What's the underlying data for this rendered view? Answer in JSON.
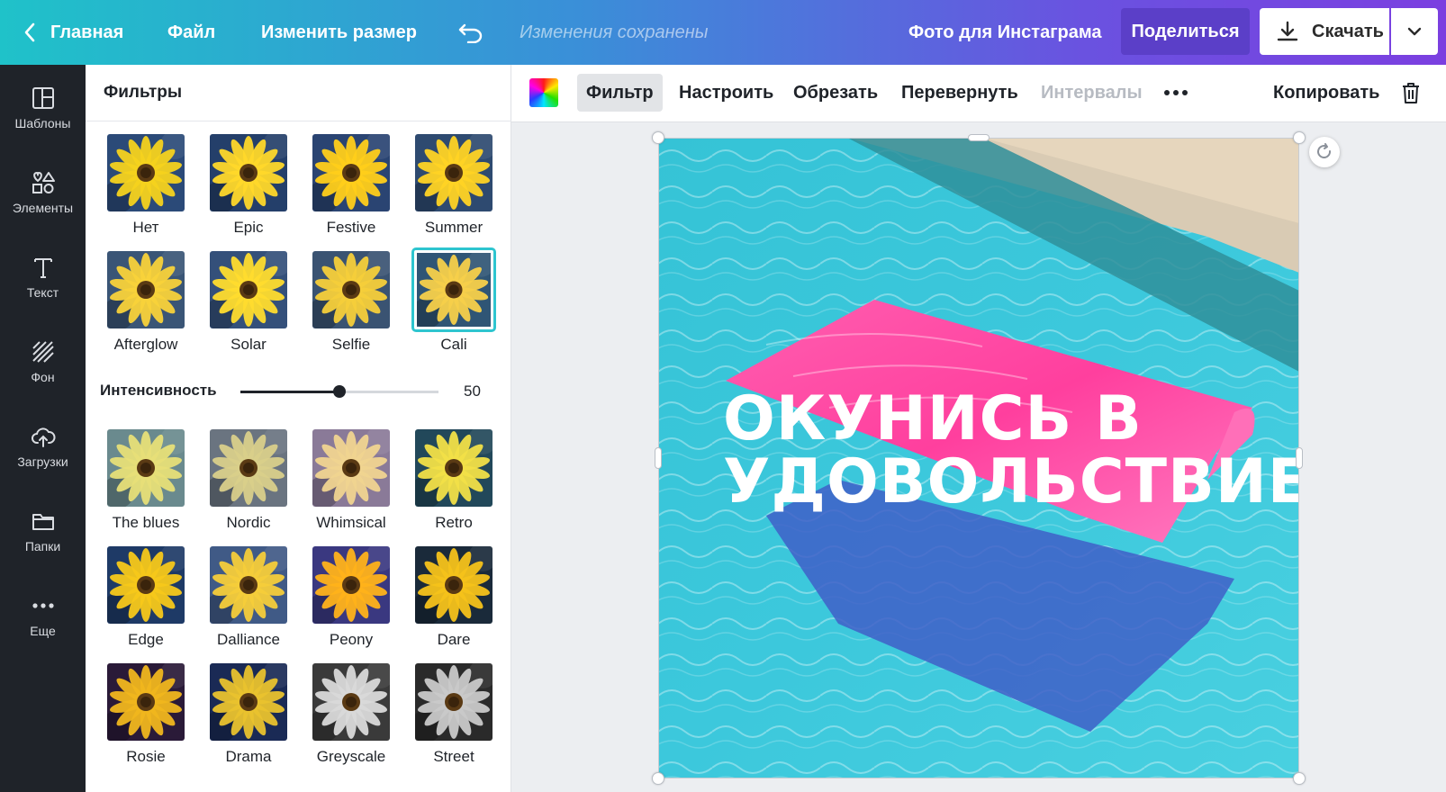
{
  "topbar": {
    "home_label": "Главная",
    "file_label": "Файл",
    "resize_label": "Изменить размер",
    "saved_status": "Изменения сохранены",
    "design_title": "Фото для Инстаграма",
    "share_label": "Поделиться",
    "download_label": "Скачать"
  },
  "sidebar": {
    "items": [
      {
        "label": "Шаблоны",
        "icon": "layout-icon"
      },
      {
        "label": "Элементы",
        "icon": "shapes-icon"
      },
      {
        "label": "Текст",
        "icon": "text-icon"
      },
      {
        "label": "Фон",
        "icon": "background-icon"
      },
      {
        "label": "Загрузки",
        "icon": "cloud-upload-icon"
      },
      {
        "label": "Папки",
        "icon": "folder-icon"
      },
      {
        "label": "Еще",
        "icon": "more-icon"
      }
    ]
  },
  "panel": {
    "title": "Фильтры",
    "intensity_label": "Интенсивность",
    "intensity_value": "50",
    "intensity_fraction": 0.5,
    "selected_filter": "Cali",
    "filters_top": [
      "Нет",
      "Epic",
      "Festive",
      "Summer",
      "Afterglow",
      "Solar",
      "Selfie",
      "Cali"
    ],
    "filters_bottom": [
      "The blues",
      "Nordic",
      "Whimsical",
      "Retro",
      "Edge",
      "Dalliance",
      "Peony",
      "Dare",
      "Rosie",
      "Drama",
      "Greyscale",
      "Street"
    ]
  },
  "toolbar": {
    "filter_label": "Фильтр",
    "adjust_label": "Настроить",
    "crop_label": "Обрезать",
    "flip_label": "Перевернуть",
    "spacing_label": "Интервалы",
    "copy_label": "Копировать"
  },
  "canvas": {
    "headline_line1": "ОКУНИСЬ В",
    "headline_line2": "УДОВОЛЬСТВИЕ"
  },
  "colors": {
    "accent": "#2ec5cf",
    "share_bg": "#5b3fc8",
    "sidebar_bg": "#1f2329"
  }
}
